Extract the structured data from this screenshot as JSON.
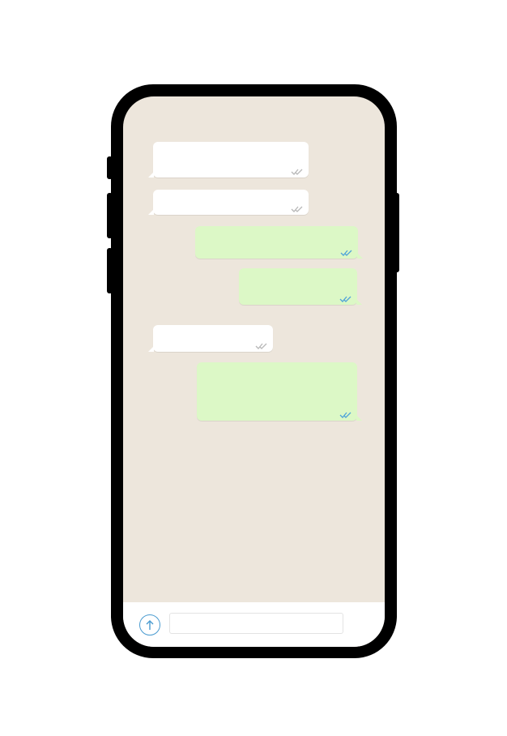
{
  "colors": {
    "phone_frame": "#000000",
    "chat_background": "#ede6dc",
    "incoming_bubble": "#ffffff",
    "outgoing_bubble": "#dcf8c6",
    "read_ticks": "#4fa3d9",
    "delivered_ticks": "#b8b8b8",
    "send_button_accent": "#4a9bd0"
  },
  "messages": [
    {
      "direction": "incoming",
      "text": "",
      "status": "delivered"
    },
    {
      "direction": "incoming",
      "text": "",
      "status": "delivered"
    },
    {
      "direction": "outgoing",
      "text": "",
      "status": "read"
    },
    {
      "direction": "outgoing",
      "text": "",
      "status": "read"
    },
    {
      "direction": "incoming",
      "text": "",
      "status": "delivered"
    },
    {
      "direction": "outgoing",
      "text": "",
      "status": "read"
    }
  ],
  "composer": {
    "value": "",
    "placeholder": "",
    "send_icon": "arrow-up-icon"
  }
}
